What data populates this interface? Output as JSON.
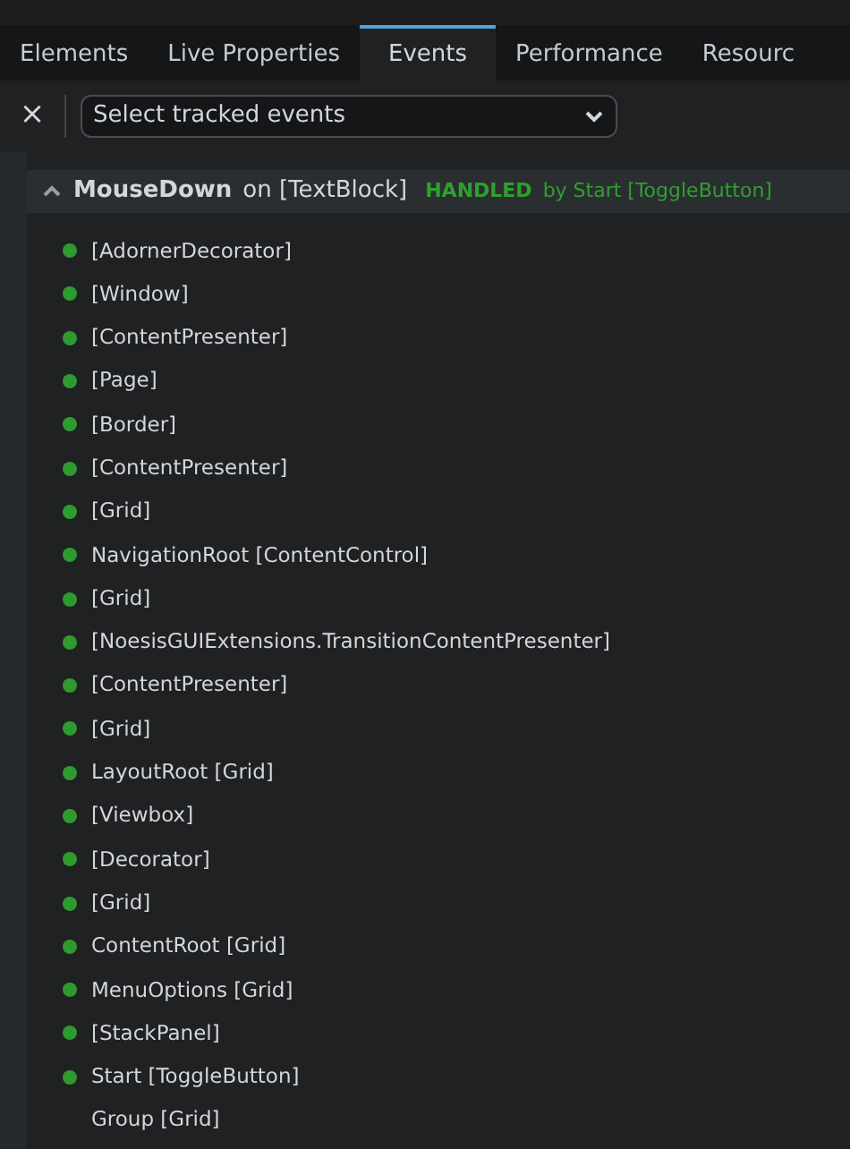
{
  "tabs": [
    {
      "label": "Elements",
      "selected": false
    },
    {
      "label": "Live Properties",
      "selected": false
    },
    {
      "label": "Events",
      "selected": true
    },
    {
      "label": "Performance",
      "selected": false
    },
    {
      "label": "Resourc",
      "selected": false
    }
  ],
  "toolbar": {
    "clear_button": "×",
    "event_select": {
      "placeholder": "Select tracked events"
    }
  },
  "event": {
    "expanded": true,
    "name": "MouseDown",
    "on_text": "on [TextBlock]",
    "handled_label": "HANDLED",
    "handled_by": "by Start [ToggleButton]",
    "route": [
      {
        "label": "[AdornerDecorator]",
        "reached": true
      },
      {
        "label": "[Window]",
        "reached": true
      },
      {
        "label": "[ContentPresenter]",
        "reached": true
      },
      {
        "label": "[Page]",
        "reached": true
      },
      {
        "label": "[Border]",
        "reached": true
      },
      {
        "label": "[ContentPresenter]",
        "reached": true
      },
      {
        "label": "[Grid]",
        "reached": true
      },
      {
        "label": "NavigationRoot [ContentControl]",
        "reached": true
      },
      {
        "label": "[Grid]",
        "reached": true
      },
      {
        "label": "[NoesisGUIExtensions.TransitionContentPresenter]",
        "reached": true
      },
      {
        "label": "[ContentPresenter]",
        "reached": true
      },
      {
        "label": "[Grid]",
        "reached": true
      },
      {
        "label": "LayoutRoot [Grid]",
        "reached": true
      },
      {
        "label": "[Viewbox]",
        "reached": true
      },
      {
        "label": "[Decorator]",
        "reached": true
      },
      {
        "label": "[Grid]",
        "reached": true
      },
      {
        "label": "ContentRoot [Grid]",
        "reached": true
      },
      {
        "label": "MenuOptions [Grid]",
        "reached": true
      },
      {
        "label": "[StackPanel]",
        "reached": true
      },
      {
        "label": "Start [ToggleButton]",
        "reached": true
      },
      {
        "label": "Group [Grid]",
        "reached": false
      }
    ]
  }
}
